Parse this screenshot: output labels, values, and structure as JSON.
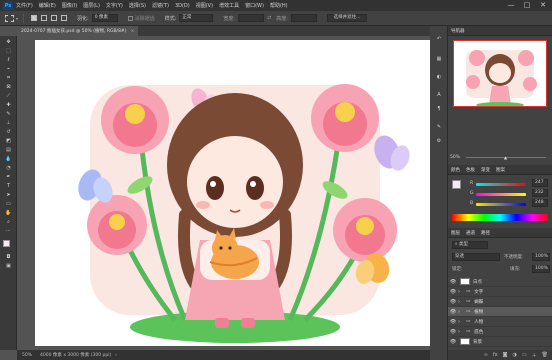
{
  "menubar": {
    "logo": "Ps",
    "items": [
      "文件(F)",
      "编辑(E)",
      "图像(I)",
      "图层(L)",
      "文字(Y)",
      "选择(S)",
      "滤镜(T)",
      "3D(D)",
      "视图(V)",
      "增效工具",
      "窗口(W)",
      "帮助(H)"
    ],
    "minimize": "—",
    "maximize": "□",
    "close": "✕"
  },
  "options": {
    "feather_label": "羽化:",
    "feather_value": "0 像素",
    "antialias": "消除锯齿",
    "style_label": "样式:",
    "style_value": "正常",
    "width_label": "宽度:",
    "height_label": "高度:",
    "select_subject": "选择并遮住..."
  },
  "document": {
    "tab_title": "2024-0707 瓶插女孩.psd @ 50% (植物, RGB/8#)",
    "tab_close": "×"
  },
  "status": {
    "zoom": "50%",
    "info": "4000 像素 x 3000 像素 (300 ppi)",
    "arrow": "›"
  },
  "navigator": {
    "tabs": [
      "导航器"
    ],
    "zoom": "50%"
  },
  "color": {
    "tabs": [
      "颜色",
      "色板",
      "渐变",
      "图案"
    ],
    "labels": [
      "R",
      "G",
      "B"
    ],
    "values": [
      "247",
      "232",
      "248"
    ]
  },
  "layers": {
    "tabs": [
      "图层",
      "通道",
      "路径"
    ],
    "filter": "类型",
    "blend": "穿透",
    "opacity_label": "不透明度:",
    "opacity": "100%",
    "lock_label": "锁定:",
    "fill_label": "填充:",
    "fill": "100%",
    "items": [
      {
        "name": "白点",
        "type": "layer"
      },
      {
        "name": "文字",
        "type": "group"
      },
      {
        "name": "蝴蝶",
        "type": "group"
      },
      {
        "name": "植物",
        "type": "group",
        "selected": true
      },
      {
        "name": "人物",
        "type": "group"
      },
      {
        "name": "底色",
        "type": "group"
      },
      {
        "name": "背景",
        "type": "layer"
      }
    ]
  },
  "colors": {
    "accent": "#31a8ff",
    "selected_layer": "#5a5a5a"
  }
}
